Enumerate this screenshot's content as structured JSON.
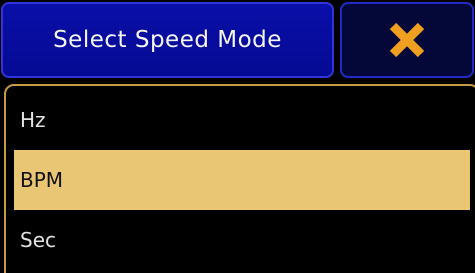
{
  "dialog": {
    "title": "Select Speed Mode",
    "close_icon": "close-x-icon",
    "colors": {
      "title_bg": "#0a0fa8",
      "close_icon": "#f0a020",
      "border_accent": "#c69a3f",
      "selected_bg": "#e9c674"
    }
  },
  "options": {
    "items": [
      {
        "label": "Hz",
        "selected": false
      },
      {
        "label": "BPM",
        "selected": true
      },
      {
        "label": "Sec",
        "selected": false
      }
    ]
  }
}
